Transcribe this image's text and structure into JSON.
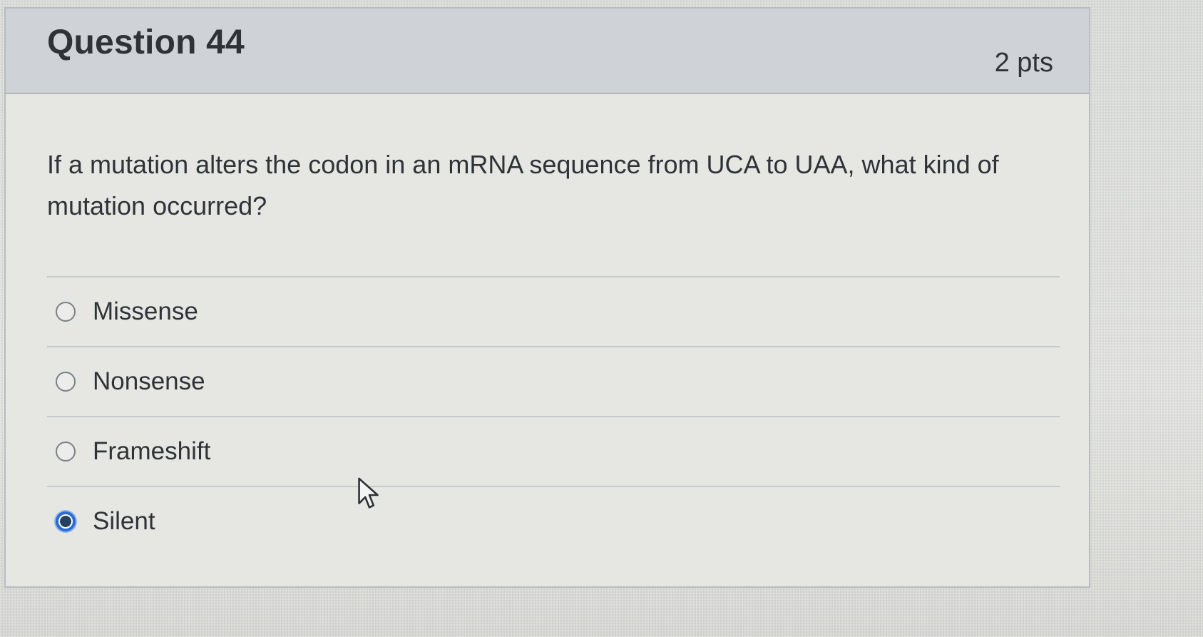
{
  "question": {
    "title": "Question 44",
    "points": "2 pts",
    "text": "If a mutation alters the codon in an mRNA sequence from UCA to UAA, what kind of mutation occurred?"
  },
  "answers": [
    {
      "label": "Missense",
      "selected": false
    },
    {
      "label": "Nonsense",
      "selected": false
    },
    {
      "label": "Frameshift",
      "selected": false
    },
    {
      "label": "Silent",
      "selected": true
    }
  ],
  "colors": {
    "header_bg": "#cfd2d6",
    "card_bg": "#e6e7e3",
    "text": "#2f3338",
    "radio_selected": "#2b6bd3"
  },
  "icons": {
    "cursor": "arrow-cursor-icon"
  }
}
